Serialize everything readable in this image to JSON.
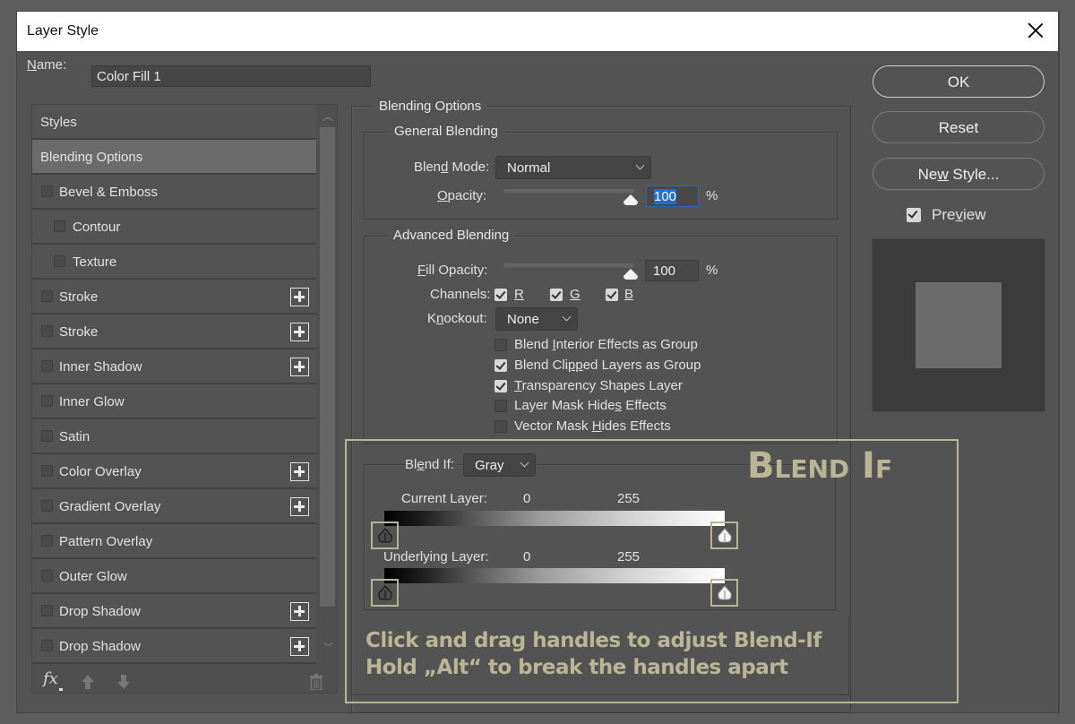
{
  "window": {
    "title": "Layer Style",
    "close_icon": "close-icon"
  },
  "name_field": {
    "label_prefix": "",
    "label_underline": "N",
    "label_rest": "ame:",
    "value": "Color Fill 1"
  },
  "styles_panel": {
    "header": "Styles",
    "active_item": "Blending Options",
    "items": [
      {
        "label": "Bevel & Emboss",
        "checked": false,
        "indent": false,
        "plus": false
      },
      {
        "label": "Contour",
        "checked": false,
        "indent": true,
        "plus": false
      },
      {
        "label": "Texture",
        "checked": false,
        "indent": true,
        "plus": false
      },
      {
        "label": "Stroke",
        "checked": false,
        "indent": false,
        "plus": true
      },
      {
        "label": "Stroke",
        "checked": false,
        "indent": false,
        "plus": true
      },
      {
        "label": "Inner Shadow",
        "checked": false,
        "indent": false,
        "plus": true
      },
      {
        "label": "Inner Glow",
        "checked": false,
        "indent": false,
        "plus": false
      },
      {
        "label": "Satin",
        "checked": false,
        "indent": false,
        "plus": false
      },
      {
        "label": "Color Overlay",
        "checked": false,
        "indent": false,
        "plus": true
      },
      {
        "label": "Gradient Overlay",
        "checked": false,
        "indent": false,
        "plus": true
      },
      {
        "label": "Pattern Overlay",
        "checked": false,
        "indent": false,
        "plus": false
      },
      {
        "label": "Outer Glow",
        "checked": false,
        "indent": false,
        "plus": false
      },
      {
        "label": "Drop Shadow",
        "checked": false,
        "indent": false,
        "plus": true
      },
      {
        "label": "Drop Shadow",
        "checked": false,
        "indent": false,
        "plus": true
      }
    ],
    "footer": {
      "fx_label": "fx",
      "icons": [
        "fx-icon",
        "move-up-icon",
        "move-down-icon",
        "trash-icon"
      ]
    }
  },
  "blending_options": {
    "title": "Blending Options",
    "general": {
      "title": "General Blending",
      "blend_mode": {
        "label_a": "Blen",
        "label_u": "d",
        "label_b": " Mode:",
        "value": "Normal"
      },
      "opacity": {
        "label_u": "O",
        "label_rest": "pacity:",
        "value": "100",
        "unit": "%",
        "fraction": 1.0
      }
    },
    "advanced": {
      "title": "Advanced Blending",
      "fill_opacity": {
        "label_u": "F",
        "label_rest": "ill Opacity:",
        "value": "100",
        "unit": "%",
        "fraction": 1.0
      },
      "channels": {
        "label": "Channels:",
        "items": [
          {
            "label": "R",
            "checked": true
          },
          {
            "label": "G",
            "checked": true
          },
          {
            "label": "B",
            "checked": true
          }
        ]
      },
      "knockout": {
        "label_a": "K",
        "label_u": "n",
        "label_b": "ockout:",
        "value": "None"
      },
      "options": [
        {
          "a": "Blend ",
          "u": "I",
          "b": "nterior Effects as Group",
          "checked": false
        },
        {
          "a": "Blend Cli",
          "u": "pp",
          "b": "ed Layers as Group",
          "checked": true
        },
        {
          "a": "",
          "u": "T",
          "b": "ransparency Shapes Layer",
          "checked": true
        },
        {
          "a": "Layer Mask Hide",
          "u": "s",
          "b": " Effects",
          "checked": false
        },
        {
          "a": "Vector Mask ",
          "u": "H",
          "b": "ides Effects",
          "checked": false
        }
      ]
    },
    "blend_if": {
      "label_a": "Bl",
      "label_u": "e",
      "label_b": "nd If:",
      "value": "Gray",
      "current_layer": {
        "label": "Current Layer:",
        "min": "0",
        "max": "255"
      },
      "underlying_layer": {
        "label": "Underlying Layer:",
        "min": "0",
        "max": "255"
      }
    }
  },
  "annotation": {
    "title": "Blend If",
    "line1": "Click and drag handles to adjust Blend-If",
    "line2": "Hold „Alt“ to break the handles apart",
    "color": "#b9b595"
  },
  "buttons": {
    "ok": "OK",
    "reset": "Reset",
    "new_style_a": "Ne",
    "new_style_u": "w",
    "new_style_b": " Style...",
    "preview_a": "Pre",
    "preview_u": "v",
    "preview_b": "iew",
    "preview_checked": true
  }
}
